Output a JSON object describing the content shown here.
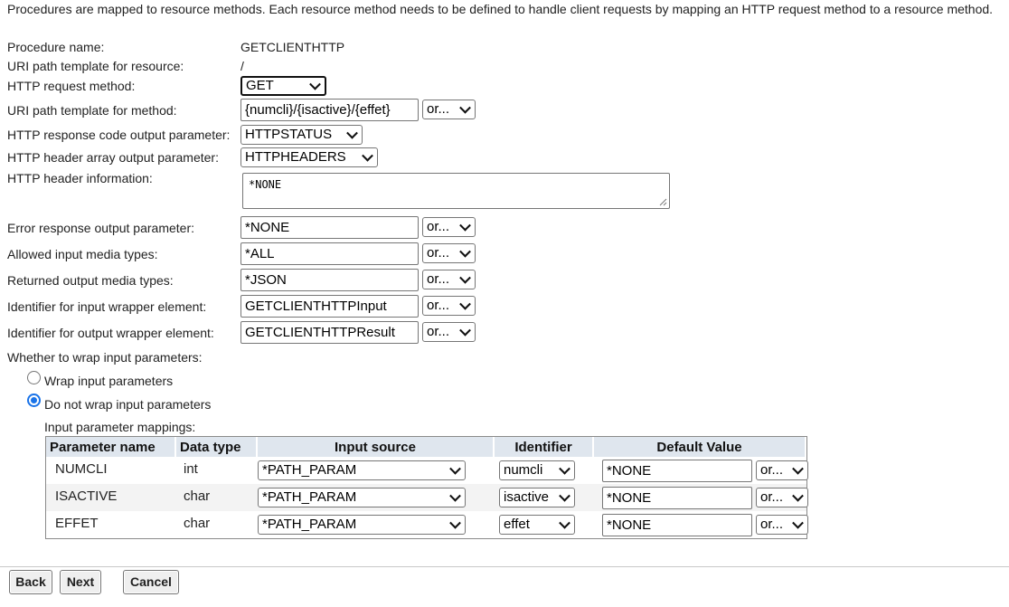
{
  "intro": "Procedures are mapped to resource methods. Each resource method needs to be defined to handle client requests by mapping an HTTP request method to a resource method.",
  "procedure": {
    "name_label": "Procedure name:",
    "name_value": "GETCLIENTHTTP",
    "uri_resource_label": "URI path template for resource:",
    "uri_resource_value": "/"
  },
  "fields": {
    "http_method_label": "HTTP request method:",
    "http_method_value": "GET",
    "uri_method_label": "URI path template for method:",
    "uri_method_value": "{numcli}/{isactive}/{effet}",
    "resp_code_label": "HTTP response code output parameter:",
    "resp_code_value": "HTTPSTATUS",
    "header_array_label": "HTTP header array output parameter:",
    "header_array_value": "HTTPHEADERS",
    "header_info_label": "HTTP header information:",
    "header_info_value": "*NONE",
    "error_resp_label": "Error response output parameter:",
    "error_resp_value": "*NONE",
    "input_media_label": "Allowed input media types:",
    "input_media_value": "*ALL",
    "output_media_label": "Returned output media types:",
    "output_media_value": "*JSON",
    "input_wrapper_label": "Identifier for input wrapper element:",
    "input_wrapper_value": "GETCLIENTHTTPInput",
    "output_wrapper_label": "Identifier for output wrapper element:",
    "output_wrapper_value": "GETCLIENTHTTPResult",
    "or_option": "or..."
  },
  "wrap": {
    "question": "Whether to wrap input parameters:",
    "option_wrap": "Wrap input parameters",
    "option_nowrap": "Do not wrap input parameters",
    "selected": "nowrap"
  },
  "mappings": {
    "title": "Input parameter mappings:",
    "headers": [
      "Parameter name",
      "Data type",
      "Input source",
      "Identifier",
      "Default Value"
    ],
    "rows": [
      {
        "name": "NUMCLI",
        "type": "int",
        "source": "*PATH_PARAM",
        "identifier": "numcli",
        "default": "*NONE",
        "or": "or..."
      },
      {
        "name": "ISACTIVE",
        "type": "char",
        "source": "*PATH_PARAM",
        "identifier": "isactive",
        "default": "*NONE",
        "or": "or..."
      },
      {
        "name": "EFFET",
        "type": "char",
        "source": "*PATH_PARAM",
        "identifier": "effet",
        "default": "*NONE",
        "or": "or..."
      }
    ]
  },
  "buttons": {
    "back": "Back",
    "next": "Next",
    "cancel": "Cancel"
  }
}
